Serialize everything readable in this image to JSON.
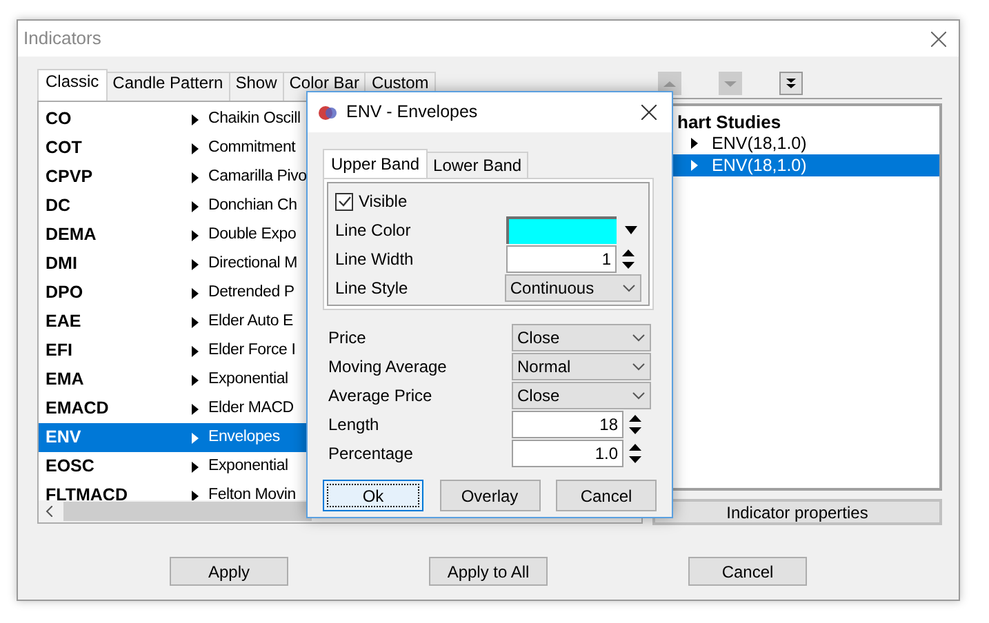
{
  "window": {
    "title": "Indicators"
  },
  "tabs": [
    {
      "label": "Classic",
      "selected": true
    },
    {
      "label": "Candle Pattern",
      "selected": false
    },
    {
      "label": "Show",
      "selected": false
    },
    {
      "label": "Color Bar",
      "selected": false
    },
    {
      "label": "Custom",
      "selected": false
    }
  ],
  "indicators": [
    {
      "code": "CO",
      "name": "Chaikin Oscill",
      "selected": false
    },
    {
      "code": "COT",
      "name": "Commitment",
      "selected": false
    },
    {
      "code": "CPVP",
      "name": "Camarilla Pivo",
      "selected": false
    },
    {
      "code": "DC",
      "name": "Donchian Ch",
      "selected": false
    },
    {
      "code": "DEMA",
      "name": "Double Expo",
      "selected": false
    },
    {
      "code": "DMI",
      "name": "Directional M",
      "selected": false
    },
    {
      "code": "DPO",
      "name": "Detrended P",
      "selected": false
    },
    {
      "code": "EAE",
      "name": "Elder Auto E",
      "selected": false
    },
    {
      "code": "EFI",
      "name": "Elder Force I",
      "selected": false
    },
    {
      "code": "EMA",
      "name": "Exponential",
      "selected": false
    },
    {
      "code": "EMACD",
      "name": "Elder MACD",
      "selected": false
    },
    {
      "code": "ENV",
      "name": "Envelopes",
      "selected": true
    },
    {
      "code": "EOSC",
      "name": "Exponential",
      "selected": false
    },
    {
      "code": "FLTMACD",
      "name": "Felton Movin",
      "selected": false
    }
  ],
  "toolbar": [
    {
      "kind": "up",
      "disabled": true
    },
    {
      "kind": "down",
      "disabled": true
    },
    {
      "kind": "bottom",
      "disabled": false
    }
  ],
  "tree": {
    "title": "hart Studies",
    "items": [
      {
        "label": "ENV(18,1.0)",
        "selected": false
      },
      {
        "label": "ENV(18,1.0)",
        "selected": true
      }
    ]
  },
  "properties_button": "Indicator properties",
  "buttons": [
    "Apply",
    "Apply to All",
    "Cancel"
  ],
  "dialog": {
    "title": "ENV - Envelopes",
    "tabs": [
      {
        "label": "Upper Band",
        "selected": true
      },
      {
        "label": "Lower Band",
        "selected": false
      }
    ],
    "visible": {
      "label": "Visible",
      "checked": true
    },
    "band_rows": [
      {
        "kind": "color",
        "label": "Line Color",
        "color": "#00ffff"
      },
      {
        "kind": "spin",
        "label": "Line Width",
        "value": "1"
      },
      {
        "kind": "select",
        "label": "Line Style",
        "value": "Continuous"
      }
    ],
    "params": [
      {
        "kind": "select",
        "label": "Price",
        "value": "Close"
      },
      {
        "kind": "select",
        "label": "Moving Average",
        "value": "Normal"
      },
      {
        "kind": "select",
        "label": "Average Price",
        "value": "Close"
      },
      {
        "kind": "spin",
        "label": "Length",
        "value": "18"
      },
      {
        "kind": "spin",
        "label": "Percentage",
        "value": "1.0"
      }
    ],
    "buttons": [
      {
        "label": "Ok",
        "focused": true
      },
      {
        "label": "Overlay",
        "focused": false
      },
      {
        "label": "Cancel",
        "focused": false
      }
    ]
  }
}
